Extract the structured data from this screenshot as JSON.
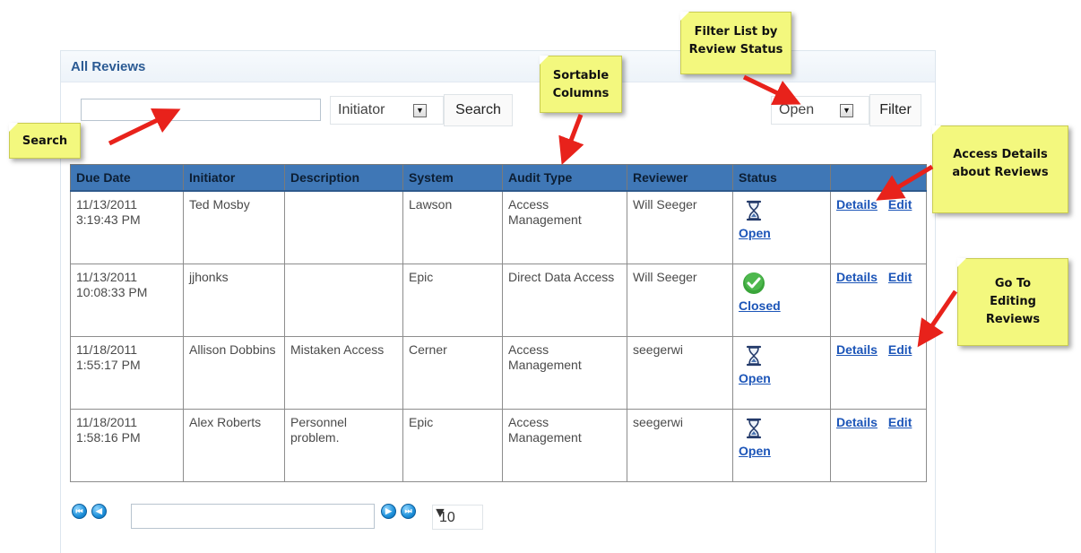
{
  "panel": {
    "title": "All Reviews"
  },
  "search": {
    "input_value": "",
    "field_select": "Initiator",
    "search_button": "Search"
  },
  "filter": {
    "status_select": "Open",
    "filter_button": "Filter"
  },
  "table": {
    "columns": [
      "Due Date",
      "Initiator",
      "Description",
      "System",
      "Audit Type",
      "Reviewer",
      "Status",
      ""
    ],
    "rows": [
      {
        "due_date_1": "11/13/2011",
        "due_date_2": "3:19:43 PM",
        "initiator": "Ted Mosby",
        "description": "",
        "system": "Lawson",
        "audit_type": "Access Management",
        "reviewer": "Will Seeger",
        "status": "Open",
        "status_icon": "hourglass-icon"
      },
      {
        "due_date_1": "11/13/2011",
        "due_date_2": "10:08:33 PM",
        "initiator": "jjhonks",
        "description": "",
        "system": "Epic",
        "audit_type": "Direct Data Access",
        "reviewer": "Will Seeger",
        "status": "Closed",
        "status_icon": "checkmark-icon"
      },
      {
        "due_date_1": "11/18/2011",
        "due_date_2": "1:55:17 PM",
        "initiator": "Allison Dobbins",
        "description": "Mistaken Access",
        "system": "Cerner",
        "audit_type": "Access Management",
        "reviewer": "seegerwi",
        "status": "Open",
        "status_icon": "hourglass-icon"
      },
      {
        "due_date_1": "11/18/2011",
        "due_date_2": "1:58:16 PM",
        "initiator": "Alex Roberts",
        "description": "Personnel problem.",
        "system": "Epic",
        "audit_type": "Access Management",
        "reviewer": "seegerwi",
        "status": "Open",
        "status_icon": "hourglass-icon"
      }
    ],
    "action_details": "Details",
    "action_edit": "Edit"
  },
  "pager": {
    "page_value": "",
    "page_size": "10"
  },
  "notes": {
    "search": "Search",
    "sortable": [
      "Sortable",
      "Columns"
    ],
    "filter": [
      "Filter List by",
      "Review Status"
    ],
    "details": [
      "Access Details",
      "about Reviews"
    ],
    "edit": [
      "Go To",
      "Editing",
      "Reviews"
    ]
  },
  "colors": {
    "header_bg": "#3f77b6",
    "link": "#1c55b8",
    "note": "#f3f87e",
    "arrow": "#e8221b"
  }
}
